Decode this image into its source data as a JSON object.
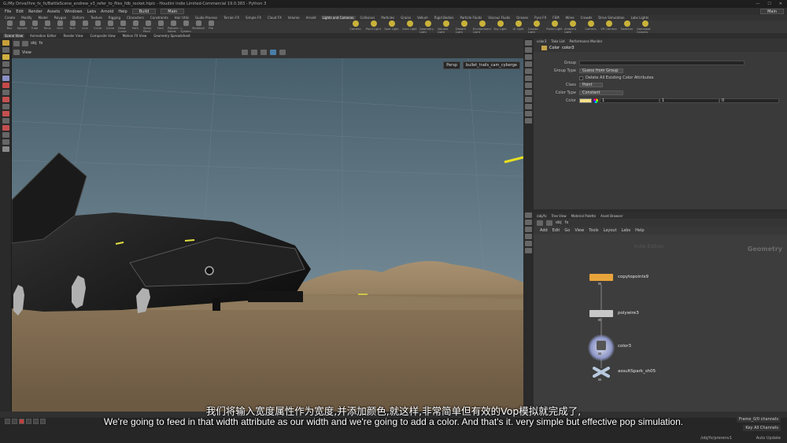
{
  "window": {
    "title": "G:/My Drive/Ihre_fx_fx/BattleScene_andrew_v3_refer_to_files_fdb_rocket.hiplc - Houdini Indie Limited-Commercial 19.0.383 - Python 3",
    "controls": [
      "—",
      "☐",
      "✕"
    ]
  },
  "menu": {
    "items": [
      "File",
      "Edit",
      "Render",
      "Assets",
      "Windows",
      "Labs",
      "Arnold",
      "Help"
    ],
    "build_label": "Build",
    "desktop_label": "Main",
    "right_label": "Main"
  },
  "shelf_tabs": [
    "Create",
    "Modify",
    "Model",
    "Polygon",
    "Deform",
    "Texture",
    "Rigging",
    "Characters",
    "Constraints",
    "Hair Utils",
    "Guide Process",
    "Terrain FX",
    "Simple FX",
    "Cloud FX",
    "Volume",
    "Arnold",
    "Lights and Cameras",
    "Collisions",
    "Particles",
    "Grains",
    "Vellum",
    "Rigid Bodies",
    "Particle Fluids",
    "Viscous Fluids",
    "Oceans",
    "Pyro FX",
    "FEM",
    "Wires",
    "Crowds",
    "Drive Simulation",
    "Labs Lights"
  ],
  "shelf_active_tab": "Lights and Cameras",
  "shelf_tools": [
    "Box",
    "Sphere",
    "Tube",
    "Torus",
    "Grid",
    "Null",
    "Line",
    "Circle",
    "Curve",
    "Draw Curve",
    "Path",
    "Spray Paint",
    "Font",
    "Platonic Solids",
    "L-System",
    "Metaball",
    "File"
  ],
  "light_tools": [
    "Camera",
    "Point Light",
    "Spot Light",
    "Area Light",
    "Geometry Light",
    "Volume Light",
    "Distant Light",
    "Environment Light",
    "Sky Light",
    "GI Light",
    "Caustic Light",
    "Portal Light",
    "Ambient Light",
    "Camera",
    "VR Camera",
    "Switcher",
    "Gamepad Camera"
  ],
  "panel_tabs": [
    "Scene View",
    "Animation Editor",
    "Render View",
    "Composite View",
    "Motion FX View",
    "Geometry Spreadsheet"
  ],
  "panel_active_tab": "Scene View",
  "viewport": {
    "path": "obj",
    "path2": "fx",
    "view_label": "View",
    "persp_label": "Persp",
    "camera_label": "bullet_trails_cam_cyberge"
  },
  "param_tabs": [
    "color3",
    "Take List",
    "Performance Monitor"
  ],
  "param_node": {
    "type": "Color",
    "name": "color3"
  },
  "params": {
    "group_label": "Group",
    "group_value": "",
    "group_type_label": "Group Type",
    "group_type_value": "Guess from Group",
    "delete_label": "Delete All Existing Color Attributes",
    "class_label": "Class",
    "class_value": "Point",
    "color_type_label": "Color Type",
    "color_type_value": "Constant",
    "color_label": "Color",
    "color_swatch": "#f3df8a",
    "color_r": "1",
    "color_g": "1",
    "color_b": "0"
  },
  "net_tabs": [
    "/obj/fx",
    "Tree View",
    "Material Palette",
    "Asset Browser"
  ],
  "net_path": [
    "obj",
    "fx"
  ],
  "net_menu": [
    "Add",
    "Edit",
    "Go",
    "View",
    "Tools",
    "Layout",
    "Labs",
    "Help"
  ],
  "net_watermark": "Geometry",
  "net_watermark2": "Indie Edition",
  "nodes": [
    {
      "name": "copytopoints9",
      "color": "#e8a43a"
    },
    {
      "name": "polywire3",
      "color": "#c8c8c8"
    },
    {
      "name": "color3",
      "color": "#9aa6c8"
    },
    {
      "name": "assultSpark_sh05",
      "color": "#b8c8de"
    }
  ],
  "timeline": {
    "right_field1": "Frame_0/0 channels",
    "right_field2": "Key All Channels",
    "path_field": "/obj/fx/prerenv1",
    "auto_update": "Auto Update"
  },
  "subtitles": {
    "zh": "我们将输入宽度属性作为宽度,并添加颜色,就这样,非常简单但有效的Vop模拟就完成了,",
    "en": "We're going to feed in that width attribute as our width and we're going to add a color. And that's it. very simple but effective pop simulation."
  },
  "colors": {
    "sky": "#516877",
    "ground": "#73604a",
    "panel": "#3a3a3a"
  }
}
